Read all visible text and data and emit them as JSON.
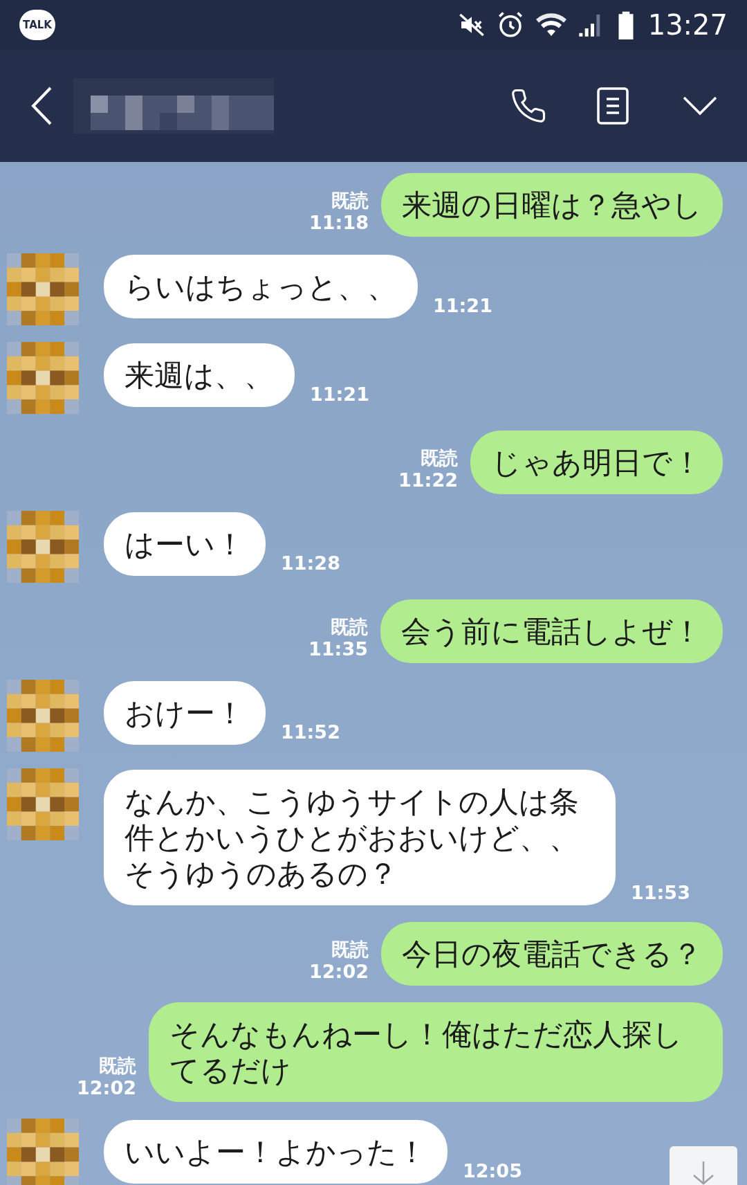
{
  "status_bar": {
    "app_badge": "TALK",
    "time": "13:27"
  },
  "messages": [
    {
      "kind": "sent",
      "text": "来週の日曜は？急やし",
      "read_label": "既読",
      "time": "11:18"
    },
    {
      "kind": "received",
      "text": "らいはちょっと、、",
      "time": "11:21"
    },
    {
      "kind": "received",
      "text": "来週は、、",
      "time": "11:21"
    },
    {
      "kind": "sent",
      "text": "じゃあ明日で！",
      "read_label": "既読",
      "time": "11:22"
    },
    {
      "kind": "received",
      "text": "はーい！",
      "time": "11:28"
    },
    {
      "kind": "sent",
      "text": "会う前に電話しよぜ！",
      "read_label": "既読",
      "time": "11:35"
    },
    {
      "kind": "received",
      "text": "おけー！",
      "time": "11:52"
    },
    {
      "kind": "received",
      "text": "なんか、こうゆうサイトの人は条件とかいうひとがおおいけど、、そうゆうのあるの？",
      "time": "11:53"
    },
    {
      "kind": "sent",
      "text": "今日の夜電話できる？",
      "read_label": "既読",
      "time": "12:02"
    },
    {
      "kind": "sent",
      "text": "そんなもんねーし！俺はただ恋人探してるだけ",
      "read_label": "既読",
      "time": "12:02"
    },
    {
      "kind": "received",
      "text": "いいよー！よかった！",
      "time": "12:05"
    }
  ]
}
